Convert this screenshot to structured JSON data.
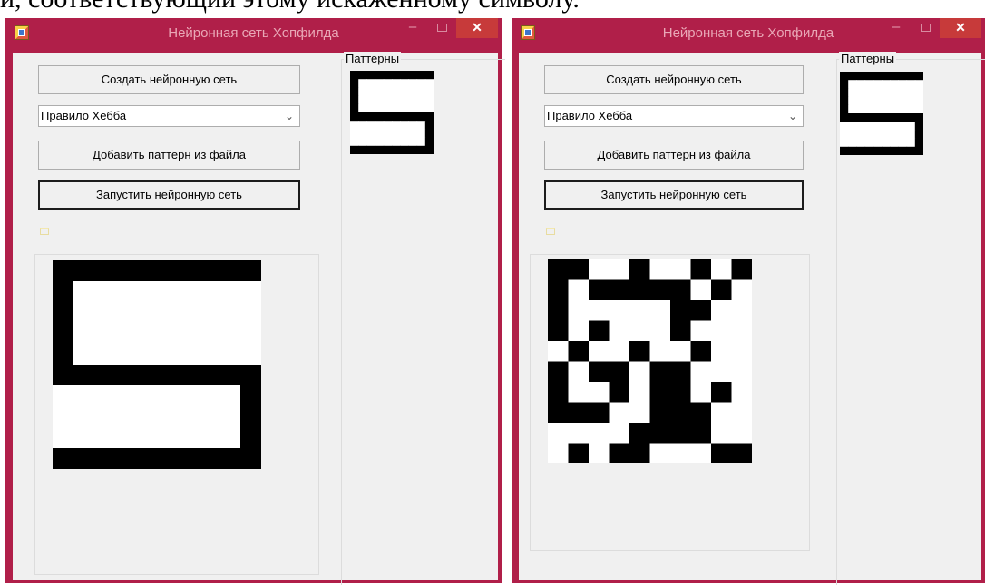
{
  "caption": "й, соответствующий этому искаженному символу.",
  "windows": [
    {
      "title": "Нейронная сеть Хопфилда",
      "create_button": "Создать нейронную сеть",
      "rule_select": "Правило Хебба",
      "add_pattern_button": "Добавить паттерн из файла",
      "run_button": "Запустить нейронную сеть",
      "patterns_label": "Паттерны",
      "pattern_grid": [
        "1111111111",
        "1000000000",
        "1000000000",
        "1000000000",
        "1000000000",
        "1111111111",
        "0000000001",
        "0000000001",
        "0000000001",
        "1111111111"
      ],
      "main_grid": [
        "1111111111",
        "1000000000",
        "1000000000",
        "1000000000",
        "1000000000",
        "1111111111",
        "0000000001",
        "0000000001",
        "0000000001",
        "1111111111"
      ]
    },
    {
      "title": "Нейронная сеть Хопфилда",
      "create_button": "Создать нейронную сеть",
      "rule_select": "Правило Хебба",
      "add_pattern_button": "Добавить паттерн из файла",
      "run_button": "Запустить нейронную сеть",
      "patterns_label": "Паттерны",
      "pattern_grid": [
        "1111111111",
        "1000000000",
        "1000000000",
        "1000000000",
        "1000000000",
        "1111111111",
        "0000000001",
        "0000000001",
        "0000000001",
        "1111111111"
      ],
      "main_grid": [
        "1100100101",
        "1011111010",
        "1000001100",
        "1010001000",
        "0100100100",
        "1011011000",
        "1001011010",
        "1110011100",
        "0000111100",
        "0101100011"
      ]
    }
  ],
  "colors": {
    "window_border": "#b01f49",
    "client_background": "#f0f0f0",
    "close_button": "#c73a3a",
    "pixel_on": "#000000",
    "pixel_off": "#ffffff"
  }
}
